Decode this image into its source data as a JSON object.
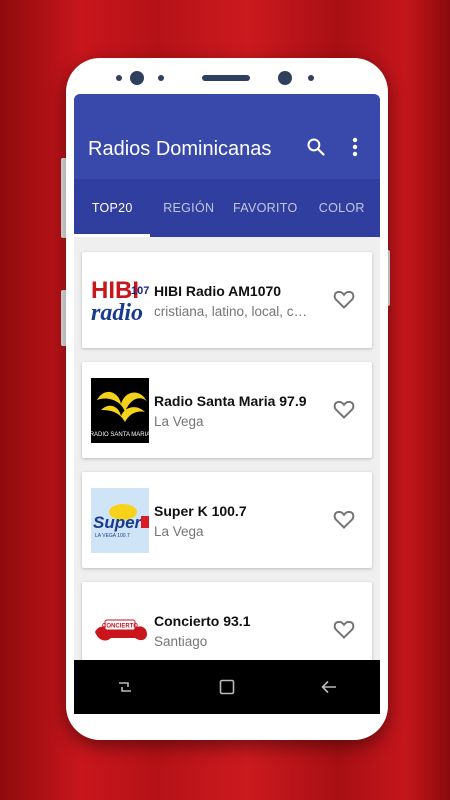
{
  "app": {
    "title": "Radios Dominicanas",
    "colors": {
      "primary": "#3949ab",
      "primary_dark": "#303f9f",
      "background": "#c8161c"
    }
  },
  "tabs": [
    {
      "label": "TOP20",
      "active": true
    },
    {
      "label": "REGIÓN",
      "active": false
    },
    {
      "label": "FAVORITO",
      "active": false
    },
    {
      "label": "COLOR",
      "active": false
    }
  ],
  "stations": [
    {
      "name": "HIBI Radio AM1070",
      "subtitle": "cristiana, latino, local, conservador",
      "logo_text": "HIBI radio",
      "logo_text_2": "107"
    },
    {
      "name": "Radio Santa Maria 97.9",
      "subtitle": "La Vega",
      "logo_text": "RADIO SANTA MARIA"
    },
    {
      "name": "Super K 100.7",
      "subtitle": "La Vega",
      "logo_text": "Super",
      "logo_text_2": "LA VEGA 100.7"
    },
    {
      "name": "Concierto 93.1",
      "subtitle": "Santiago",
      "logo_text": "CONCIERTO"
    }
  ],
  "icons": {
    "search": "search-icon",
    "menu": "more-vert-icon",
    "favorite": "heart-outline-icon",
    "nav_back": "back-icon",
    "nav_home": "home-icon",
    "nav_recent": "recents-icon"
  }
}
